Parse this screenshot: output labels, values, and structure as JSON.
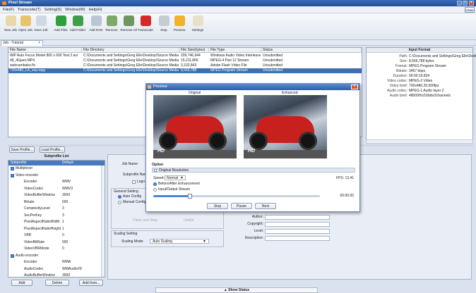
{
  "app": {
    "title": "Pixel Stream",
    "close_label": "Close"
  },
  "menu": [
    "File(F)",
    "Transcode(T)",
    "Setting(S)",
    "Window(W)",
    "Help(H)"
  ],
  "toolbar": [
    {
      "label": "New Job",
      "icon": "new-job-icon",
      "color": "#e9d9a8"
    },
    {
      "label": "Open Job",
      "icon": "open-job-icon",
      "color": "#e8c36a"
    },
    {
      "label": "Save Job",
      "icon": "save-job-icon",
      "color": "#d0d8e2"
    },
    {
      "label": "Add Files",
      "icon": "add-files-icon",
      "color": "#2f9e3c"
    },
    {
      "label": "Add Folder",
      "icon": "add-folder-icon",
      "color": "#3f9e48"
    },
    {
      "label": "Add DVD",
      "icon": "add-dvd-icon",
      "color": "#b8c6d6"
    },
    {
      "label": "Remove",
      "icon": "remove-icon",
      "color": "#7fa86a"
    },
    {
      "label": "Remove All",
      "icon": "remove-all-icon",
      "color": "#6f9560"
    },
    {
      "label": "Transcode",
      "icon": "transcode-icon",
      "color": "#d52a2a"
    },
    {
      "label": "Stop",
      "icon": "stop-icon",
      "color": "#c6ccd4"
    },
    {
      "label": "Preview",
      "icon": "preview-icon",
      "color": "#f2b32a"
    },
    {
      "label": "Settings",
      "icon": "settings-icon",
      "color": "#e8e1c8"
    }
  ],
  "doc_tab": "Job - Tutorial",
  "file_columns": [
    "File Name",
    "File Directory",
    "File Size(bytes)",
    "File Type",
    "Status"
  ],
  "files": [
    [
      "IMP Auto Focus Model 800 x 600 Test 2.avi",
      "C:\\Documents and Settings\\Greg Elle\\Desktop\\Source Media",
      "209,746,944",
      "Windows Audio Video Interleaved",
      "Unsubmitted"
    ],
    [
      "48_4Gpeo.MP4",
      "C:\\Documents and Settings\\Greg Elle\\Desktop\\Source Media",
      "15,211,866",
      "MPEG-4 Part 12 Stream",
      "Unsubmitted"
    ],
    [
      "webcambabo.flv",
      "C:\\Documents and Settings\\Greg Elle\\Desktop\\Source Media",
      "3,102,843",
      "Adobe Flash Video File",
      "Unsubmitted"
    ],
    [
      "720x480_LA_vep.mpg",
      "C:\\Documents and Settings\\Greg Elle\\Desktop\\Source Media",
      "8,566,788",
      "MPEG Program Stream",
      "Unsubmitted"
    ]
  ],
  "input_format": {
    "header": "Input Format",
    "rows": [
      [
        "Path:",
        "C:\\Documents and Settings\\Greg Elle\\Desktop\\So"
      ],
      [
        "Size:",
        "8,566,788 bytes"
      ],
      [
        "Format:",
        "MPEG Program Stream"
      ],
      [
        "Bitrate:",
        "3457 kbps"
      ],
      [
        "Duration:",
        "00:00:19.824"
      ],
      [
        "Video codec:",
        "MPEG-2 Video"
      ],
      [
        "Video brief:",
        "720x480,25.000fps"
      ],
      [
        "Audio codec:",
        "MPEG-1 Audio layer 2"
      ],
      [
        "Audio brief:",
        "48000Hz/16bits/2channels"
      ]
    ]
  },
  "profile_buttons": [
    "Save Profile...",
    "Load Profile..."
  ],
  "subprofile": {
    "title": "Subprofile List",
    "columns": [
      "Subprofile",
      "Default"
    ],
    "rows": [
      {
        "name": "Multiplexer",
        "value": "",
        "indent": 0,
        "group": true
      },
      {
        "name": "Video encoder",
        "value": "",
        "indent": 0,
        "group": true
      },
      {
        "name": "Encoder",
        "value": "WMV",
        "indent": 1
      },
      {
        "name": "VideoCodec",
        "value": "WMV3",
        "indent": 1
      },
      {
        "name": "VideoBufferWindow",
        "value": "3000",
        "indent": 1
      },
      {
        "name": "Bitrate",
        "value": "690",
        "indent": 1
      },
      {
        "name": "ComplexityLevel",
        "value": "3",
        "indent": 1
      },
      {
        "name": "SecPerKey",
        "value": "3",
        "indent": 1
      },
      {
        "name": "PixelAspectRatioWidth",
        "value": "1",
        "indent": 1
      },
      {
        "name": "PixelAspectRatioHeight",
        "value": "1",
        "indent": 1
      },
      {
        "name": "VBR",
        "value": "0",
        "indent": 1
      },
      {
        "name": "VideoBitRate",
        "value": "690",
        "indent": 1
      },
      {
        "name": "VideoVBRMode",
        "value": "0",
        "indent": 1
      },
      {
        "name": "Audio encoder",
        "value": "",
        "indent": 0,
        "group": true
      },
      {
        "name": "Encoder",
        "value": "WMA",
        "indent": 1
      },
      {
        "name": "AudioCodec",
        "value": "WMAudioV8",
        "indent": 1
      },
      {
        "name": "AudioBufferWindow",
        "value": "3000",
        "indent": 1
      }
    ],
    "buttons": [
      "Add",
      "Delete",
      "Add from..."
    ]
  },
  "job": {
    "job_name_label": "Job Name",
    "subprofile_name_label": "Subprofile Name",
    "logo_label": "Logo",
    "general_setting": "General Setting",
    "auto_config": "Auto Config",
    "manual_config": "Manual Config",
    "clean_and_stop": "Clean and Stop",
    "useful": "Useful",
    "scaling_setting": "Scaling Setting",
    "scaling_mode_label": "Scaling Mode:",
    "scaling_mode": "Auto Scaling",
    "meta_labels": [
      "Author:",
      "Copyright:",
      "Level:",
      "Description:"
    ]
  },
  "preview": {
    "title": "Preview",
    "original_label": "Original",
    "enhanced_label": "Enhanced",
    "hd_badge": "HD",
    "option_label": "Option",
    "original_resolution": "Original Resolution",
    "speed_label": "Speed:",
    "speed_value": "Normal",
    "fps": "FPS: 13.41",
    "before_after": "Before/After Enhancement",
    "input_output": "Input/Output Stream",
    "time": "00:00:30",
    "progress": 0.22,
    "buttons": [
      "Stop",
      "Pause",
      "Next"
    ]
  },
  "status_bar": "▲ Show Status"
}
